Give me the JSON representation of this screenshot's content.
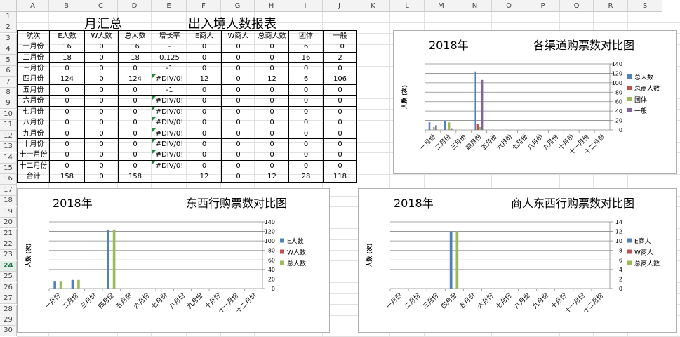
{
  "column_headers": [
    "A",
    "B",
    "C",
    "D",
    "E",
    "F",
    "G",
    "H",
    "I",
    "J",
    "K",
    "L",
    "M",
    "N",
    "O",
    "P",
    "Q",
    "R",
    "S"
  ],
  "row_headers": [
    "1",
    "2",
    "3",
    "4",
    "5",
    "6",
    "7",
    "8",
    "9",
    "10",
    "11",
    "12",
    "13",
    "14",
    "15",
    "16",
    "17",
    "18",
    "19",
    "20",
    "21",
    "22",
    "23",
    "24",
    "25",
    "26",
    "27",
    "28",
    "29",
    "30"
  ],
  "selected_row": "24",
  "sheet": {
    "title_left": "月汇总",
    "title_right": "出入境人数报表"
  },
  "table": {
    "headers": [
      "航次",
      "E人数",
      "W人数",
      "总人数",
      "增长率",
      "E商人",
      "W商人",
      "总商人数",
      "团体",
      "一般"
    ],
    "rows": [
      [
        "一月份",
        "16",
        "0",
        "16",
        "-",
        "0",
        "0",
        "0",
        "6",
        "10"
      ],
      [
        "二月份",
        "18",
        "0",
        "18",
        "0.125",
        "0",
        "0",
        "0",
        "16",
        "2"
      ],
      [
        "三月份",
        "0",
        "0",
        "0",
        "-1",
        "0",
        "0",
        "0",
        "0",
        "0"
      ],
      [
        "四月份",
        "124",
        "0",
        "124",
        "#DIV/0!",
        "12",
        "0",
        "12",
        "6",
        "106"
      ],
      [
        "五月份",
        "0",
        "0",
        "0",
        "-1",
        "0",
        "0",
        "0",
        "0",
        "0"
      ],
      [
        "六月份",
        "0",
        "0",
        "0",
        "#DIV/0!",
        "0",
        "0",
        "0",
        "0",
        "0"
      ],
      [
        "七月份",
        "0",
        "0",
        "0",
        "#DIV/0!",
        "0",
        "0",
        "0",
        "0",
        "0"
      ],
      [
        "八月份",
        "0",
        "0",
        "0",
        "#DIV/0!",
        "0",
        "0",
        "0",
        "0",
        "0"
      ],
      [
        "九月份",
        "0",
        "0",
        "0",
        "#DIV/0!",
        "0",
        "0",
        "0",
        "0",
        "0"
      ],
      [
        "十月份",
        "0",
        "0",
        "0",
        "#DIV/0!",
        "0",
        "0",
        "0",
        "0",
        "0"
      ],
      [
        "十一月份",
        "0",
        "0",
        "0",
        "#DIV/0!",
        "0",
        "0",
        "0",
        "0",
        "0"
      ],
      [
        "十二月份",
        "0",
        "0",
        "0",
        "#DIV/0!",
        "0",
        "0",
        "0",
        "0",
        "0"
      ],
      [
        "合计",
        "158",
        "0",
        "158",
        "",
        "12",
        "0",
        "12",
        "28",
        "118"
      ]
    ],
    "flagged_column": 4,
    "flagged_rows": [
      3,
      5,
      6,
      7,
      8,
      9,
      10,
      11
    ]
  },
  "chart_data": [
    {
      "type": "bar",
      "year_label": "2018年",
      "title": "各渠道购票数对比图",
      "ylabel": "人数 (次)",
      "categories": [
        "一月份",
        "二月份",
        "三月份",
        "四月份",
        "五月份",
        "六月份",
        "七月份",
        "八月份",
        "九月份",
        "十月份",
        "十一月份",
        "十二月份"
      ],
      "series": [
        {
          "name": "总人数",
          "color": "#4f81bd",
          "values": [
            16,
            18,
            0,
            124,
            0,
            0,
            0,
            0,
            0,
            0,
            0,
            0
          ]
        },
        {
          "name": "总商人数",
          "color": "#c0504d",
          "values": [
            0,
            0,
            0,
            12,
            0,
            0,
            0,
            0,
            0,
            0,
            0,
            0
          ]
        },
        {
          "name": "团体",
          "color": "#9bbb59",
          "values": [
            6,
            16,
            0,
            6,
            0,
            0,
            0,
            0,
            0,
            0,
            0,
            0
          ]
        },
        {
          "name": "一般",
          "color": "#8064a2",
          "values": [
            10,
            2,
            0,
            106,
            0,
            0,
            0,
            0,
            0,
            0,
            0,
            0
          ]
        }
      ],
      "yticks": [
        "0",
        "20",
        "40",
        "60",
        "80",
        "100",
        "120",
        "140"
      ],
      "ylim": [
        0,
        140
      ],
      "grid": true,
      "legend": "right",
      "axis_right": true
    },
    {
      "type": "bar",
      "year_label": "2018年",
      "title": "东西行购票数对比图",
      "ylabel": "人数 (次)",
      "categories": [
        "一月份",
        "二月份",
        "三月份",
        "四月份",
        "五月份",
        "六月份",
        "七月份",
        "八月份",
        "九月份",
        "十月份",
        "十一月份",
        "十二月份"
      ],
      "series": [
        {
          "name": "E人数",
          "color": "#4f81bd",
          "values": [
            16,
            18,
            0,
            124,
            0,
            0,
            0,
            0,
            0,
            0,
            0,
            0
          ]
        },
        {
          "name": "W人数",
          "color": "#c0504d",
          "values": [
            0,
            0,
            0,
            0,
            0,
            0,
            0,
            0,
            0,
            0,
            0,
            0
          ]
        },
        {
          "name": "总人数",
          "color": "#9bbb59",
          "values": [
            16,
            18,
            0,
            124,
            0,
            0,
            0,
            0,
            0,
            0,
            0,
            0
          ]
        }
      ],
      "yticks": [
        "0",
        "20",
        "40",
        "60",
        "80",
        "100",
        "120",
        "140"
      ],
      "ylim": [
        0,
        140
      ],
      "grid": true,
      "legend": "right",
      "axis_right": true
    },
    {
      "type": "bar",
      "year_label": "2018年",
      "title": "商人东西行购票数对比图",
      "ylabel": "人数 (次)",
      "categories": [
        "一月份",
        "二月份",
        "三月份",
        "四月份",
        "五月份",
        "六月份",
        "七月份",
        "八月份",
        "九月份",
        "十月份",
        "十一月份",
        "十二月份"
      ],
      "series": [
        {
          "name": "E商人",
          "color": "#4f81bd",
          "values": [
            0,
            0,
            0,
            12,
            0,
            0,
            0,
            0,
            0,
            0,
            0,
            0
          ]
        },
        {
          "name": "W商人",
          "color": "#c0504d",
          "values": [
            0,
            0,
            0,
            0,
            0,
            0,
            0,
            0,
            0,
            0,
            0,
            0
          ]
        },
        {
          "name": "总商人数",
          "color": "#9bbb59",
          "values": [
            0,
            0,
            0,
            12,
            0,
            0,
            0,
            0,
            0,
            0,
            0,
            0
          ]
        }
      ],
      "yticks": [
        "0",
        "2",
        "4",
        "6",
        "8",
        "10",
        "12",
        "14"
      ],
      "ylim": [
        0,
        14
      ],
      "grid": true,
      "legend": "right",
      "axis_right": true
    }
  ]
}
